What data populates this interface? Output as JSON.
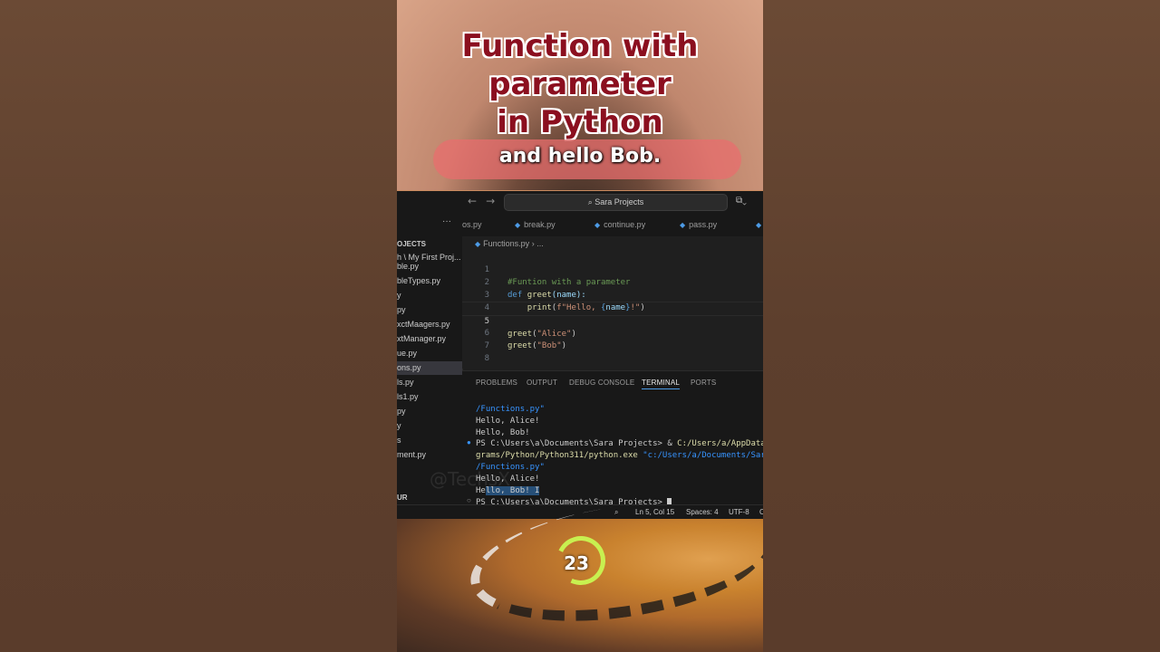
{
  "overlay": {
    "title_lines": [
      "Function with",
      "parameter",
      "in Python"
    ],
    "caption": "and hello Bob.",
    "counter": "23",
    "watermark": "@TechsX"
  },
  "window": {
    "search_placeholder": "Sara Projects",
    "back_icon": "←",
    "forward_icon": "→",
    "copilot_icon": "⧉⌄"
  },
  "explorer": {
    "more_icon": "···",
    "section_label": "OJECTS",
    "files": [
      "h \\ My First Proj...",
      "ble.py",
      "bleTypes.py",
      "y",
      "py",
      "xctMaagers.py",
      "xtManager.py",
      "ue.py",
      "ons.py",
      "ls.py",
      "ls1.py",
      "py",
      "y",
      "s",
      "ment.py"
    ],
    "active_index": 8,
    "outline_label": "UR"
  },
  "tabs": [
    {
      "label": "os.py"
    },
    {
      "label": "break.py"
    },
    {
      "label": "continue.py"
    },
    {
      "label": "pass.py"
    }
  ],
  "editor": {
    "breadcrumb_file": "Functions.py",
    "breadcrumb_more": "...",
    "lines": [
      {
        "num": "1"
      },
      {
        "num": "2"
      },
      {
        "num": "3"
      },
      {
        "num": "4"
      },
      {
        "num": "5"
      },
      {
        "num": "6"
      },
      {
        "num": "7"
      },
      {
        "num": "8"
      }
    ],
    "code": {
      "l1": "#Funtion with a parameter",
      "l2_kw": "def",
      "l2_fn": "greet",
      "l2_rest": "(name):",
      "l3_fn": "print",
      "l3_open": "(",
      "l3_str1": "f\"Hello, ",
      "l3_brace_open": "{",
      "l3_var": "name",
      "l3_brace_close": "}",
      "l3_str2": "!\"",
      "l3_close": ")",
      "l5_fn": "greet",
      "l5_arg": "\"Alice\"",
      "l6_fn": "greet",
      "l6_arg": "\"Bob\""
    }
  },
  "panel": {
    "tabs": [
      "PROBLEMS",
      "OUTPUT",
      "DEBUG CONSOLE",
      "TERMINAL",
      "PORTS"
    ],
    "active_tab": "TERMINAL",
    "terminal": {
      "t1": "/Functions.py\"",
      "t2": "Hello, Alice!",
      "t3": "Hello, Bob!",
      "t4_prompt": "PS C:\\Users\\a\\Documents\\Sara Projects> & ",
      "t4_path": "C:/Users/a/AppData",
      "t5_path": "grams/Python/Python311/python.exe ",
      "t5_arg": "\"c:/Users/a/Documents/Sar",
      "t6": "/Functions.py\"",
      "t7": "Hello, Alice!",
      "t8_a": "He",
      "t8_sel": "llo, Bob!",
      "t8_cursor": " I",
      "t9": "PS C:\\Users\\a\\Documents\\Sara Projects> "
    }
  },
  "statusbar": {
    "zoom_icon": "⌕",
    "position": "Ln 5, Col 15",
    "spaces": "Spaces: 4",
    "encoding": "UTF-8",
    "extra": "C"
  }
}
